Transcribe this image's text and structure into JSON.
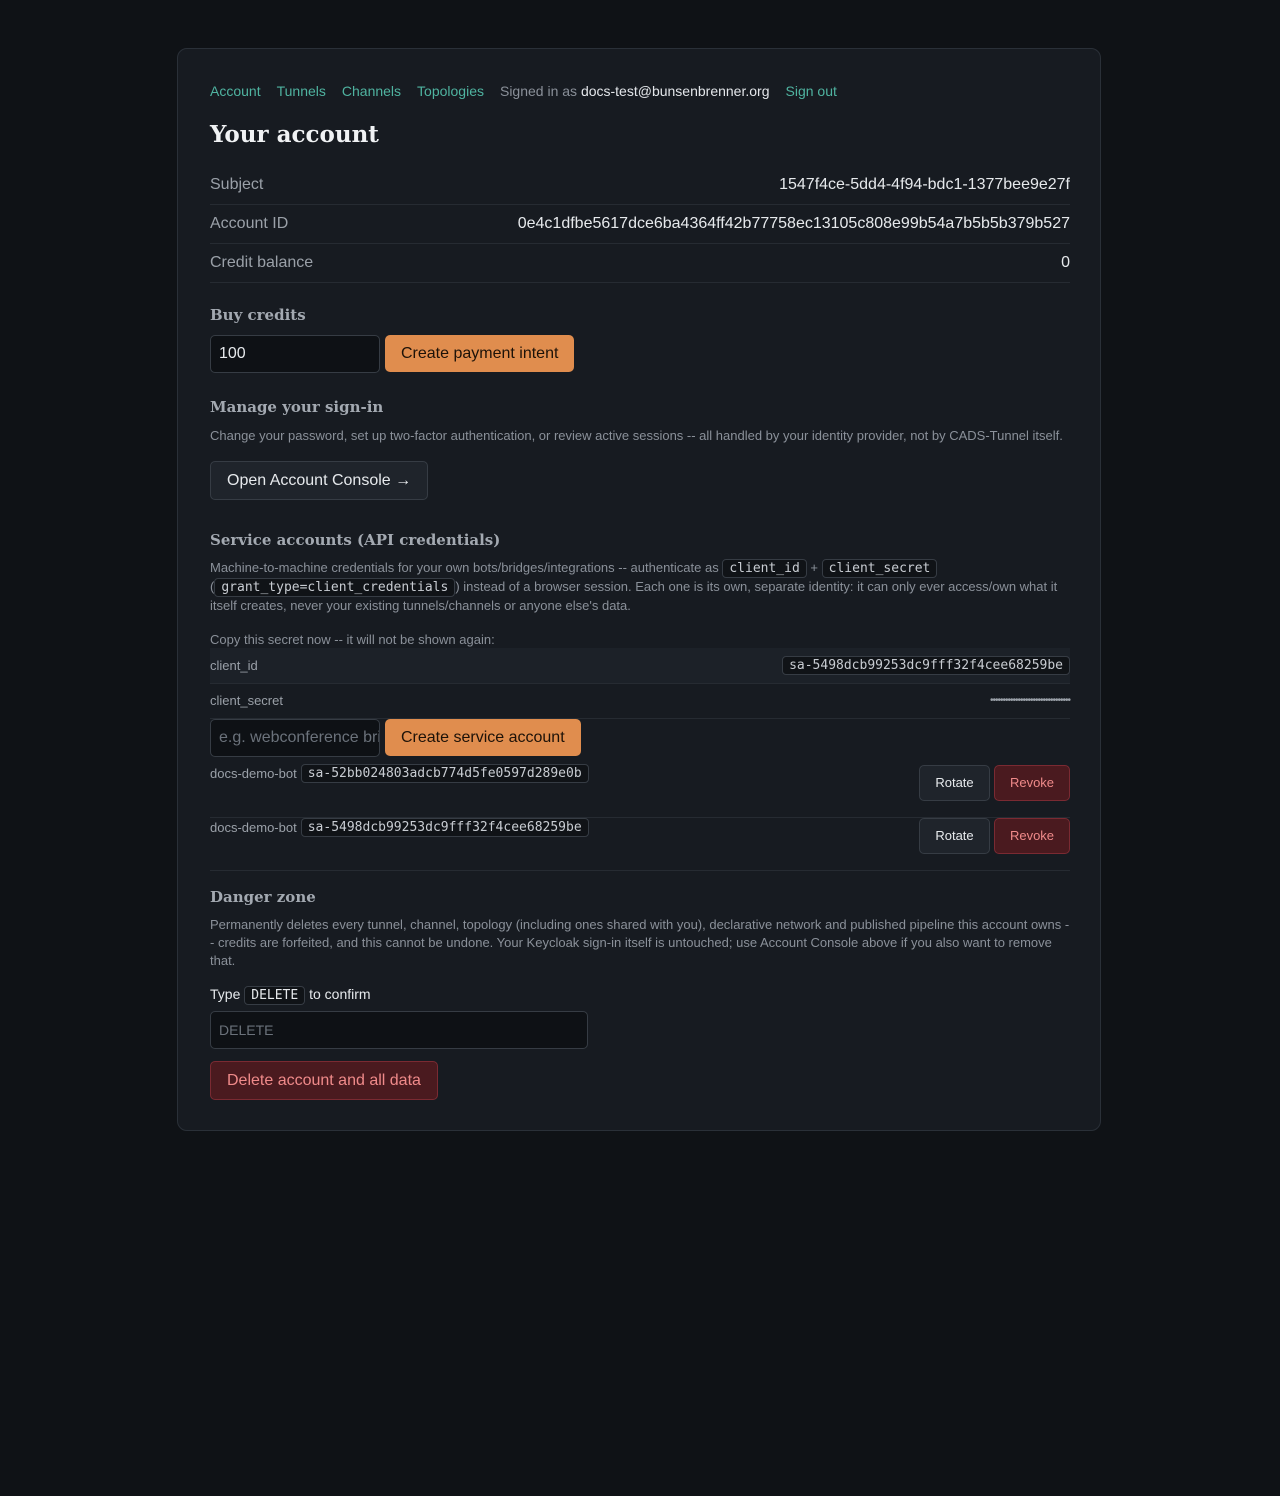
{
  "nav": {
    "links": [
      "Account",
      "Tunnels",
      "Channels",
      "Topologies"
    ],
    "signed_in_prefix": "Signed in as",
    "email": "docs-test@bunsenbrenner.org",
    "sign_out": "Sign out"
  },
  "page_title": "Your account",
  "account": {
    "rows": [
      {
        "label": "Subject",
        "value": "1547f4ce-5dd4-4f94-bdc1-1377bee9e27f"
      },
      {
        "label": "Account ID",
        "value": "0e4c1dfbe5617dce6ba4364ff42b77758ec13105c808e99b54a7b5b5b379b527"
      },
      {
        "label": "Credit balance",
        "value": "0"
      }
    ]
  },
  "buy_credits": {
    "heading": "Buy credits",
    "amount_value": "100",
    "button": "Create payment intent"
  },
  "sign_in": {
    "heading": "Manage your sign-in",
    "description": "Change your password, set up two-factor authentication, or review active sessions -- all handled by your identity provider, not by CADS-Tunnel itself.",
    "button": "Open Account Console →"
  },
  "service_accounts": {
    "heading": "Service accounts (API credentials)",
    "desc_part1": "Machine-to-machine credentials for your own bots/bridges/integrations -- authenticate as",
    "code_client_id": "client_id",
    "plus": "+",
    "code_client_secret": "client_secret",
    "paren_open": "(",
    "code_grant_type": "grant_type=client_credentials",
    "desc_part2": ") instead of a browser session. Each one is its own, separate identity: it can only ever access/own what it itself creates, never your existing tunnels/channels or anyone else's data.",
    "copy_notice": "Copy this secret now -- it will not be shown again:",
    "new_credentials": {
      "client_id_label": "client_id",
      "client_id_value": "sa-5498dcb99253dc9fff32f4cee68259be",
      "client_secret_label": "client_secret",
      "client_secret_value": "••••••••••••••••••••••••••••••••"
    },
    "name_placeholder": "e.g. webconference bridge",
    "create_button": "Create service account",
    "list": [
      {
        "name": "docs-demo-bot",
        "id": "sa-52bb024803adcb774d5fe0597d289e0b",
        "rotate": "Rotate",
        "revoke": "Revoke"
      },
      {
        "name": "docs-demo-bot",
        "id": "sa-5498dcb99253dc9fff32f4cee68259be",
        "rotate": "Rotate",
        "revoke": "Revoke"
      }
    ]
  },
  "danger": {
    "heading": "Danger zone",
    "description": "Permanently deletes every tunnel, channel, topology (including ones shared with you), declarative network and published pipeline this account owns -- credits are forfeited, and this cannot be undone. Your Keycloak sign-in itself is untouched; use Account Console above if you also want to remove that.",
    "type_prefix": "Type",
    "type_code": "DELETE",
    "type_suffix": "to confirm",
    "confirm_placeholder": "DELETE",
    "delete_button": "Delete account and all data"
  },
  "colors": {
    "accent_link": "#4fb3a0",
    "primary_button": "#e08d4e",
    "danger_button_bg": "#4a1a1f",
    "danger_text": "#ef8a8a",
    "page_bg": "#0f1216",
    "card_bg": "#171b21"
  }
}
